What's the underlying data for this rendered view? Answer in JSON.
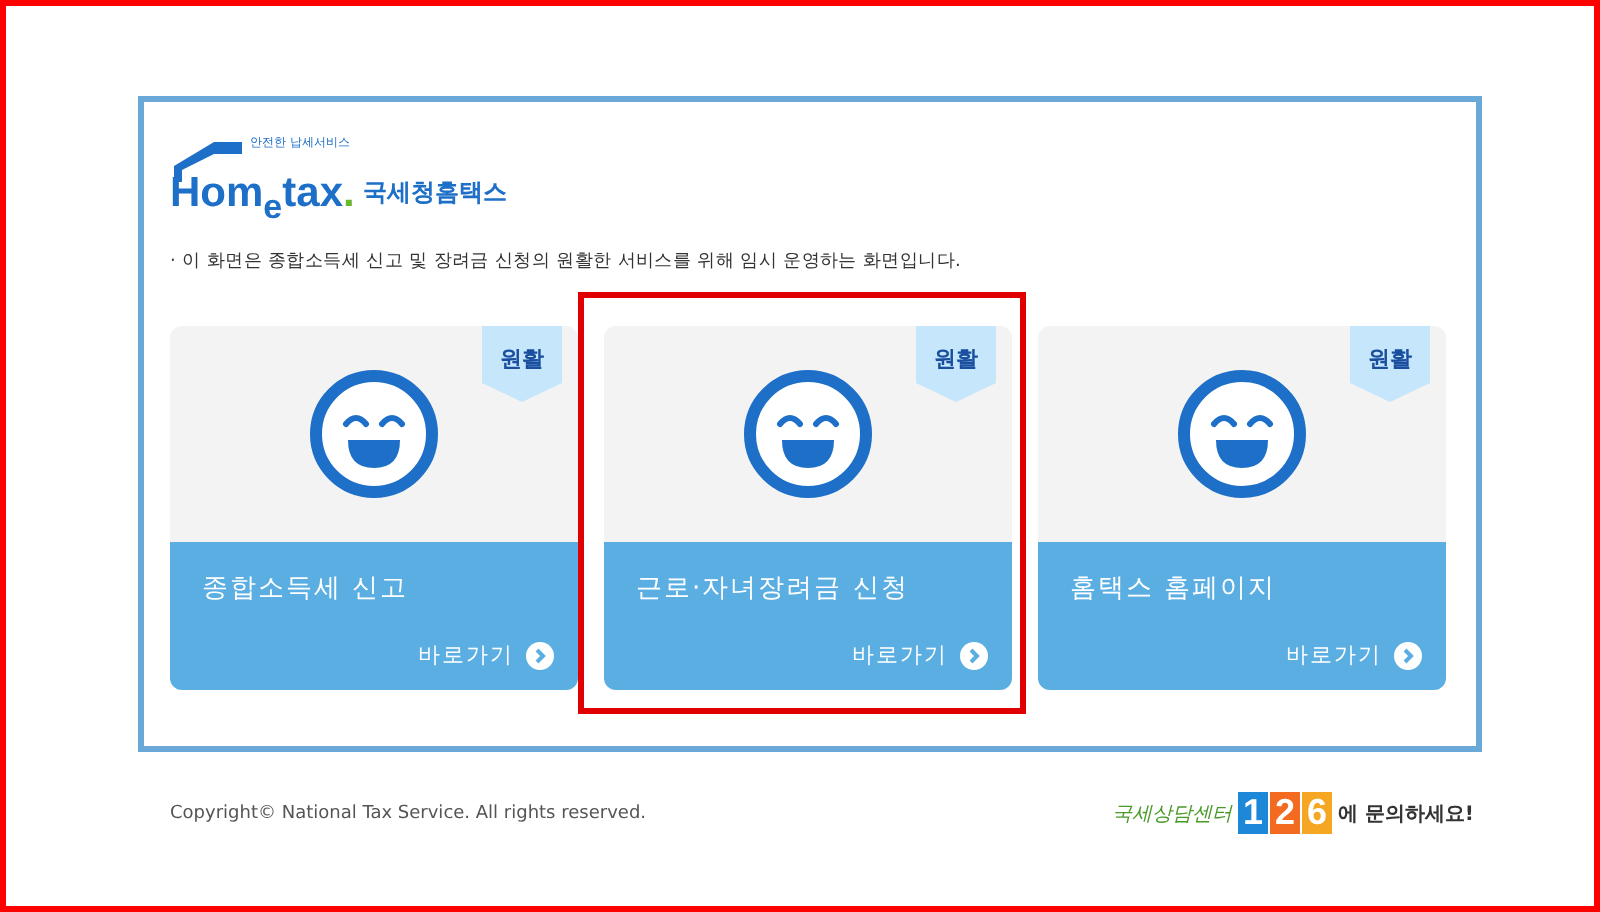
{
  "logo": {
    "tagline": "안전한 납세서비스",
    "wordmark_start": "Hom",
    "wordmark_e": "e",
    "wordmark_end": "tax",
    "wordmark_dot": ".",
    "korean_name": "국세청홈택스"
  },
  "notice": "· 이 화면은 종합소득세 신고 및 장려금 신청의 원활한 서비스를 위해 임시 운영하는 화면입니다.",
  "cards": [
    {
      "badge": "원활",
      "title": "종합소득세 신고",
      "link": "바로가기",
      "highlighted": false
    },
    {
      "badge": "원활",
      "title": "근로·자녀장려금 신청",
      "link": "바로가기",
      "highlighted": true
    },
    {
      "badge": "원활",
      "title": "홈택스 홈페이지",
      "link": "바로가기",
      "highlighted": false
    }
  ],
  "footer": {
    "copyright": "Copyright© National Tax Service. All rights reserved.",
    "center_name": "국세상담센터",
    "digits": [
      {
        "digit": "1",
        "color": "#1e88d8"
      },
      {
        "digit": "2",
        "color": "#f26b21"
      },
      {
        "digit": "6",
        "color": "#f5a623"
      }
    ],
    "contact": "에 문의하세요!"
  }
}
